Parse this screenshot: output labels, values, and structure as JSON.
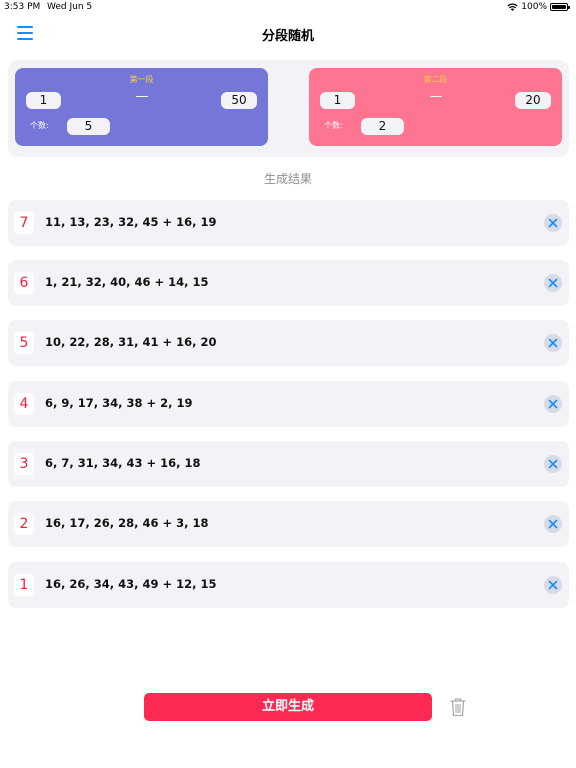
{
  "status_bar": {
    "time": "3:53 PM",
    "date": "Wed Jun 5",
    "battery": "100%"
  },
  "nav": {
    "title": "分段随机",
    "menu_icon": "hamburger-menu-icon"
  },
  "segments": [
    {
      "title": "第一段",
      "min": "1",
      "dash": "—",
      "max": "50",
      "count_label": "个数:",
      "count": "5",
      "color": "#7477d8"
    },
    {
      "title": "第二段",
      "min": "1",
      "dash": "—",
      "max": "20",
      "count_label": "个数:",
      "count": "2",
      "color": "#fd7591"
    }
  ],
  "results_title": "生成结果",
  "results": [
    {
      "index": "7",
      "text": "11, 13, 23, 32, 45 + 16, 19"
    },
    {
      "index": "6",
      "text": "1, 21, 32, 40, 46 + 14, 15"
    },
    {
      "index": "5",
      "text": "10, 22, 28, 31, 41 + 16, 20"
    },
    {
      "index": "4",
      "text": "6, 9, 17, 34, 38 + 2, 19"
    },
    {
      "index": "3",
      "text": "6, 7, 31, 34, 43 + 16, 18"
    },
    {
      "index": "2",
      "text": "16, 17, 26, 28, 46 + 3, 18"
    },
    {
      "index": "1",
      "text": "16, 26, 34, 43, 49 + 12, 15"
    }
  ],
  "footer": {
    "generate_label": "立即生成",
    "trash_icon": "trash-icon"
  },
  "colors": {
    "accent_blue": "#1a8cff",
    "generate_red": "#fe2a54",
    "index_red": "#f0203e"
  }
}
